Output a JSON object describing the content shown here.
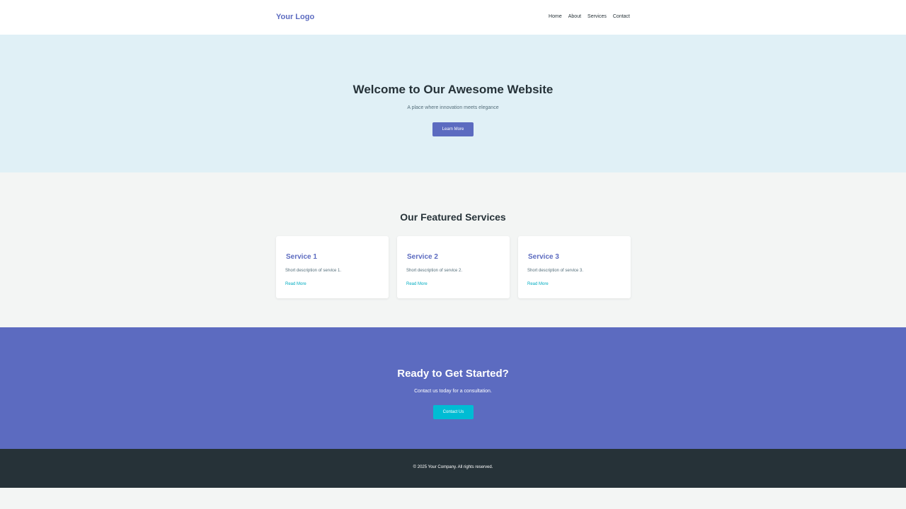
{
  "header": {
    "logo": "Your Logo",
    "nav": [
      "Home",
      "About",
      "Services",
      "Contact"
    ]
  },
  "hero": {
    "title": "Welcome to Our Awesome Website",
    "subtitle": "A place where innovation meets elegance",
    "button": "Learn More"
  },
  "services": {
    "title": "Our Featured Services",
    "cards": [
      {
        "title": "Service 1",
        "description": "Short description of service 1.",
        "link": "Read More"
      },
      {
        "title": "Service 2",
        "description": "Short description of service 2.",
        "link": "Read More"
      },
      {
        "title": "Service 3",
        "description": "Short description of service 3.",
        "link": "Read More"
      }
    ]
  },
  "cta": {
    "title": "Ready to Get Started?",
    "subtitle": "Contact us today for a consultation.",
    "button": "Contact Us"
  },
  "footer": {
    "copyright": "© 2025 Your Company. All rights reserved."
  },
  "colors": {
    "primary": "#5c6bc0",
    "accent": "#00bcd4",
    "hero_bg": "#e0f0f6",
    "dark": "#263238",
    "page_bg": "#f3f5f4"
  }
}
